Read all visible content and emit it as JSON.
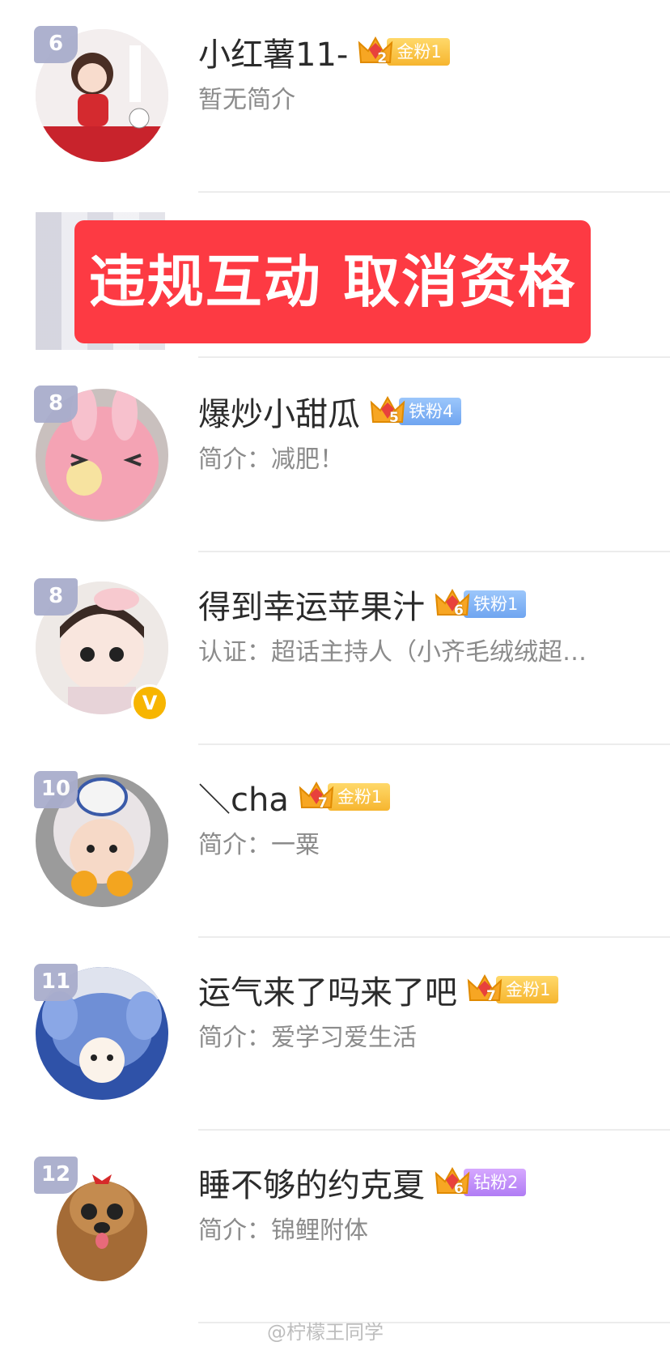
{
  "rows": [
    {
      "rank": "6",
      "name": "小红薯11-",
      "level": "2",
      "badge": "金粉1",
      "badge_type": "gold",
      "desc": "暂无简介",
      "verified": false,
      "avatar": "girl-red-sweater"
    },
    {
      "rank": "8",
      "name": "爆炒小甜瓜",
      "level": "5",
      "badge": "铁粉4",
      "badge_type": "iron",
      "desc": "简介：减肥！",
      "verified": false,
      "avatar": "pink-bunny-plush"
    },
    {
      "rank": "8",
      "name": "得到幸运苹果汁",
      "level": "6",
      "badge": "铁粉1",
      "badge_type": "iron",
      "desc": "认证：超话主持人（小齐毛绒绒超…",
      "verified": true,
      "avatar": "doll-with-bunny-hat"
    },
    {
      "rank": "10",
      "name": "＼cha",
      "level": "7",
      "badge": "金粉1",
      "badge_type": "gold",
      "desc": "简介：一粟",
      "verified": false,
      "avatar": "child-duck-hat"
    },
    {
      "rank": "11",
      "name": "运气来了吗来了吧",
      "level": "7",
      "badge": "金粉1",
      "badge_type": "gold",
      "desc": "简介：爱学习爱生活",
      "verified": false,
      "avatar": "stitch-plush-bag"
    },
    {
      "rank": "12",
      "name": "睡不够的约克夏",
      "level": "6",
      "badge": "钻粉2",
      "badge_type": "diamond",
      "desc": "简介：锦鲤附体",
      "verified": false,
      "avatar": "yorkshire-dog"
    }
  ],
  "banner": "违规互动 取消资格",
  "verify_mark": "V",
  "watermark": "@柠檬王同学",
  "colors": {
    "banner": "#fd3a43",
    "rank_bg": "#a9adcc",
    "gold": "#f6b52f",
    "iron": "#6fa5f0",
    "diamond": "#b07cf4"
  }
}
